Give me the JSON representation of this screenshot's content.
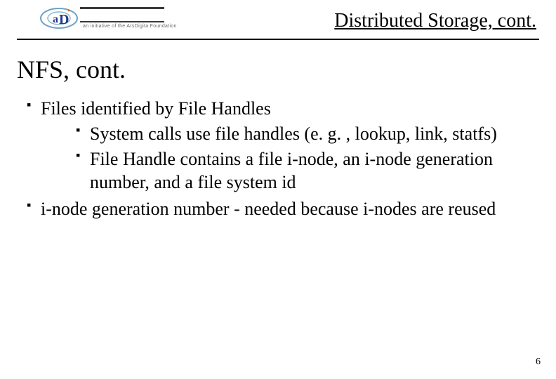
{
  "header": {
    "title": "Distributed Storage, cont.",
    "logo_tagline": "an initiative of the ArsDigita Foundation"
  },
  "section_title": "NFS, cont.",
  "bullets": [
    {
      "text": "Files identified by File Handles",
      "children": [
        {
          "text": "System calls use file handles (e. g. , lookup, link, statfs)"
        },
        {
          "text": "File Handle contains a file i-node, an i-node generation number, and a file system id"
        }
      ]
    },
    {
      "text": "i-node generation number - needed because i-nodes are reused"
    }
  ],
  "page_number": "6"
}
